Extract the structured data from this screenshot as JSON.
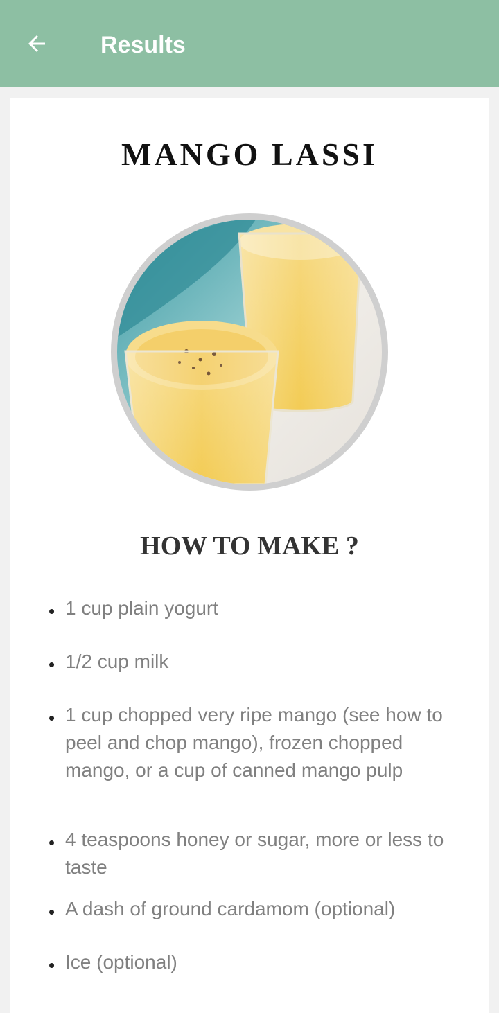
{
  "appbar": {
    "back_icon": "arrow-left-icon",
    "title": "Results",
    "color": "#8dbfa3"
  },
  "recipe": {
    "title": "MANGO LASSI",
    "photo": "mango-lassi-glasses-photo",
    "section_title": "HOW TO MAKE ?",
    "bullet": "•",
    "ingredients": [
      "1 cup plain yogurt",
      "1/2 cup milk",
      "1 cup chopped very ripe mango (see how to peel and chop mango), frozen chopped mango, or a cup of canned mango pulp",
      "4 teaspoons honey or sugar, more or less to taste",
      "A dash of ground cardamom (optional)",
      "Ice (optional)"
    ]
  }
}
